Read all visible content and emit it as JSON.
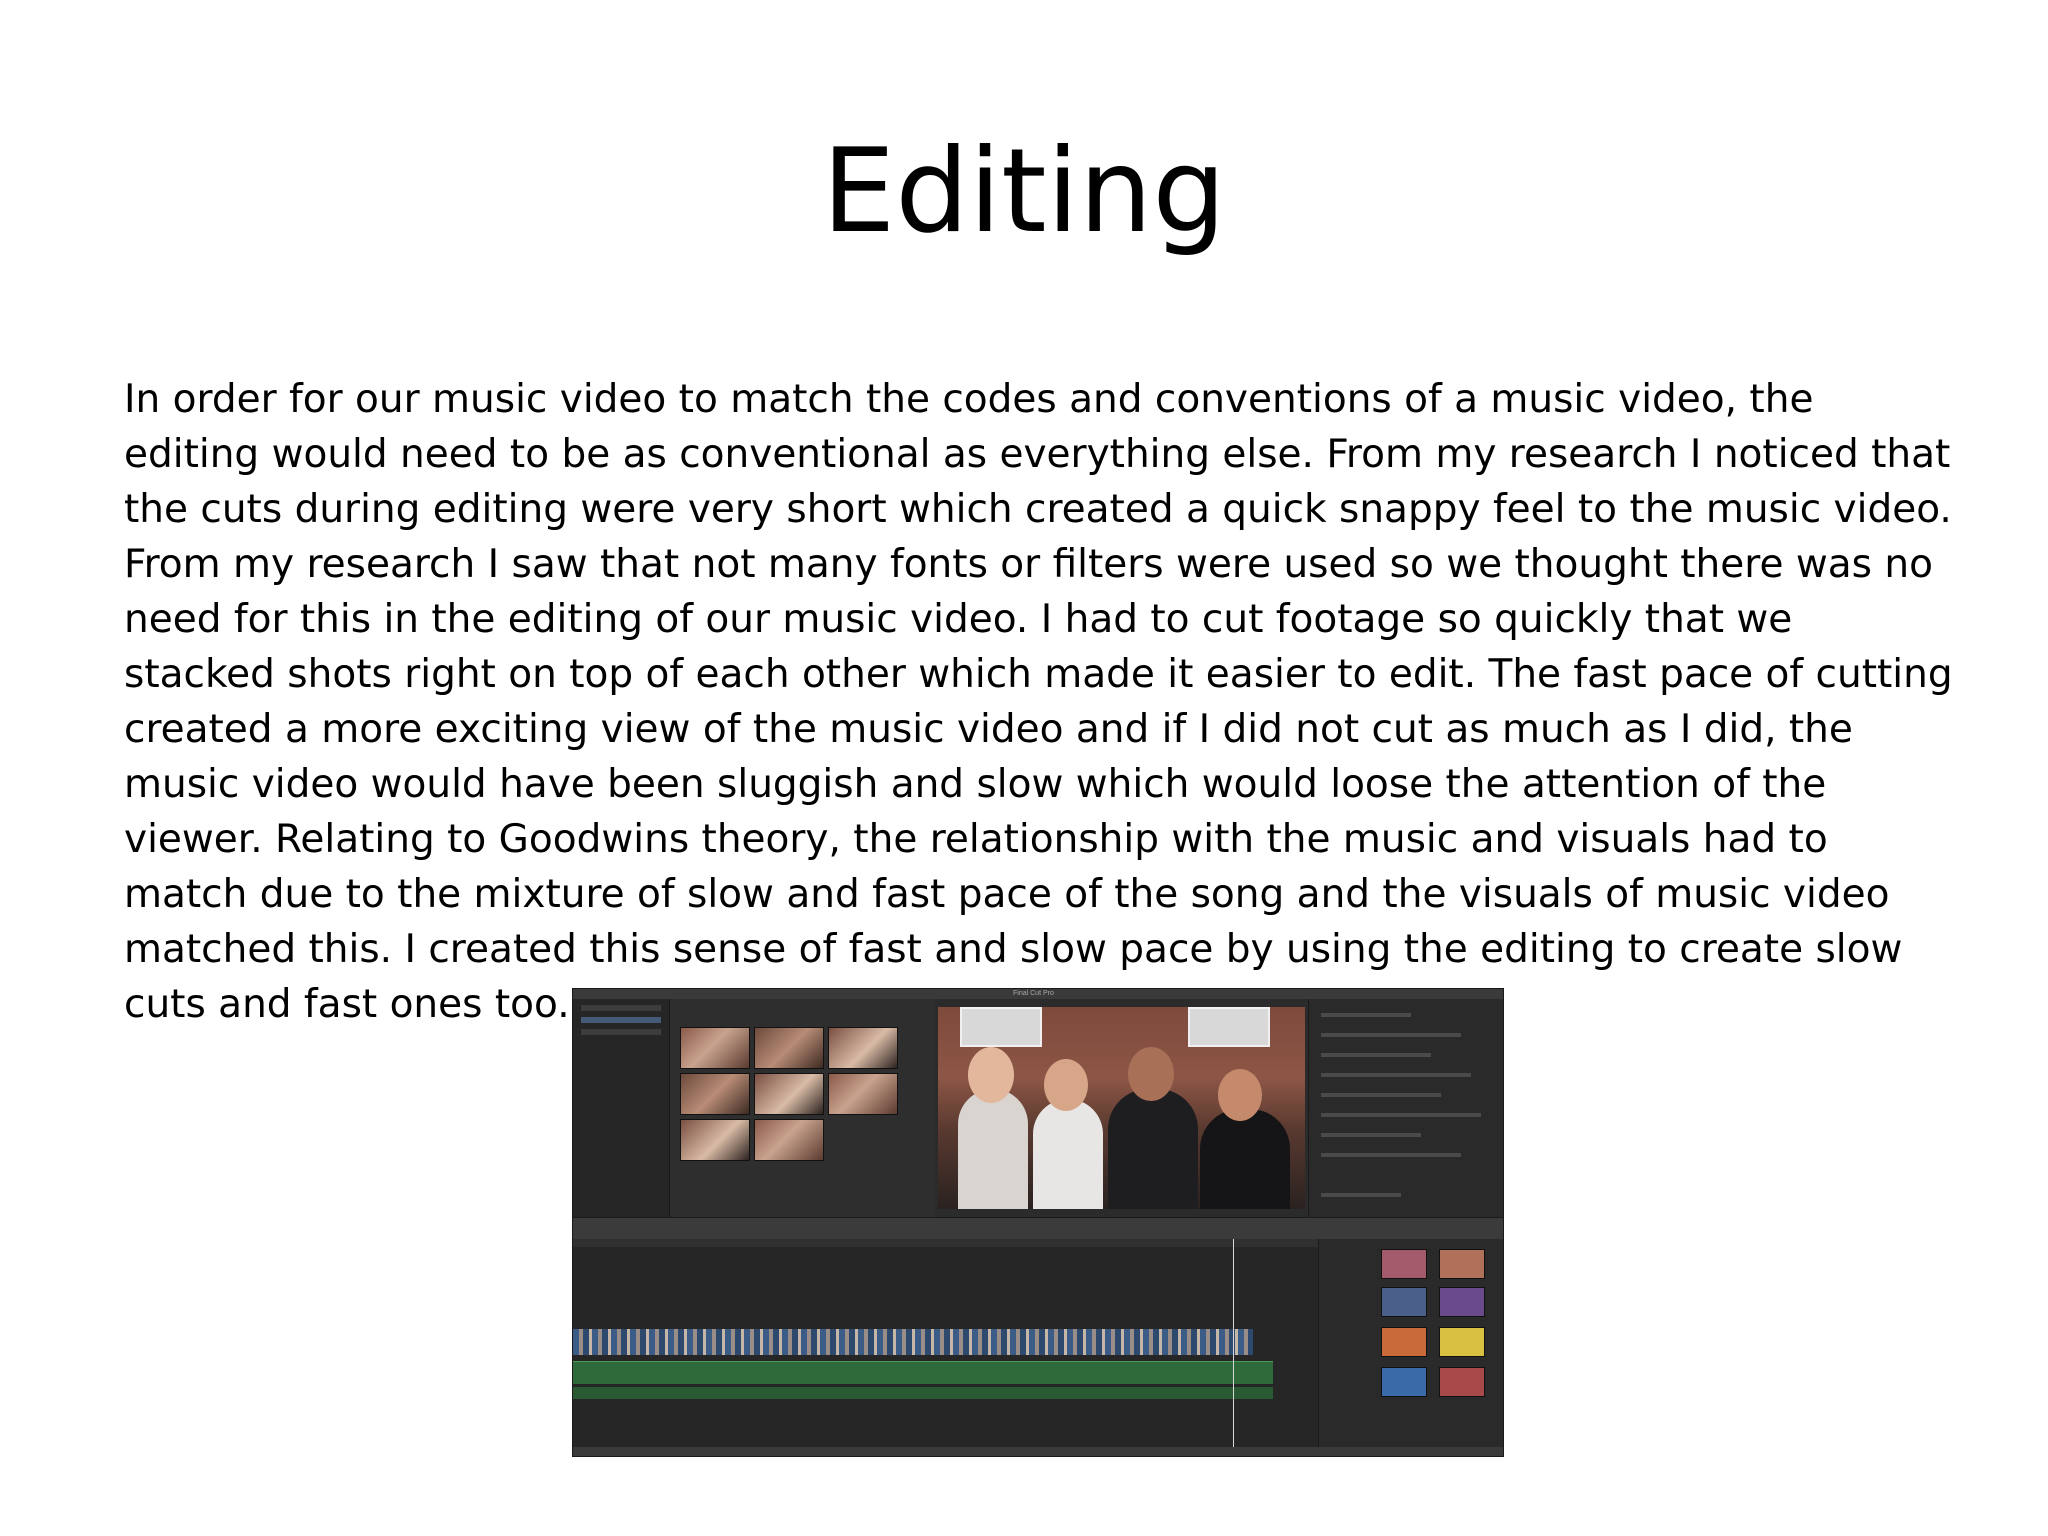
{
  "slide": {
    "title": "Editing",
    "body": "In order for our music video to match the codes and conventions of a music video, the editing would need to be as conventional as everything else. From my research I noticed that the cuts during editing were very short which created a quick snappy feel to the music video. From my research I saw that not many fonts or filters were used so we thought there was no need for this in the editing of our music video. I had to cut footage so quickly that we stacked shots right on top of each other which made it easier to edit. The fast pace of cutting created a more exciting view of the music video and if I did not cut as much as I did, the music video would have been sluggish and slow which would loose the attention of the viewer. Relating to Goodwins theory, the relationship with the music and visuals had to match due to the mixture of slow and fast pace of the song and the visuals of music video matched this. I created this sense of fast and slow pace by using the editing to create slow cuts and fast ones too."
  },
  "screenshot": {
    "window_title": "Final Cut Pro"
  }
}
